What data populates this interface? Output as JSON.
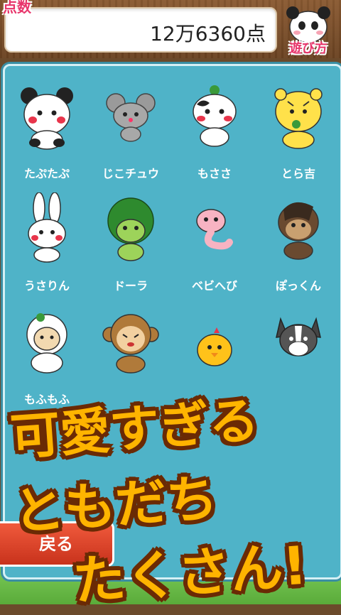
{
  "header": {
    "score_label": "点数",
    "score_value": "12万6360点",
    "howto_label": "遊び方"
  },
  "characters": [
    {
      "name": "たぷたぷ",
      "icon": "panda-icon"
    },
    {
      "name": "じこチュウ",
      "icon": "mouse-icon"
    },
    {
      "name": "もささ",
      "icon": "cow-icon"
    },
    {
      "name": "とら吉",
      "icon": "tiger-icon"
    },
    {
      "name": "うさりん",
      "icon": "rabbit-icon"
    },
    {
      "name": "ドーラ",
      "icon": "dragon-icon"
    },
    {
      "name": "ベビへび",
      "icon": "snake-icon"
    },
    {
      "name": "ぽっくん",
      "icon": "horse-icon"
    },
    {
      "name": "もふもふ",
      "icon": "sheep-icon"
    },
    {
      "name": "",
      "icon": "monkey-icon"
    },
    {
      "name": "",
      "icon": "chick-icon"
    },
    {
      "name": "",
      "icon": "dog-icon"
    }
  ],
  "back_button": "戻る",
  "promo": {
    "line1": "可愛すぎる",
    "line2": "ともだち",
    "line3": "たくさん!"
  },
  "colors": {
    "panel": "#4fb3c8",
    "accent_pink": "#e8356b",
    "promo_fill": "#ffb400",
    "back_button": "#e0452a"
  }
}
